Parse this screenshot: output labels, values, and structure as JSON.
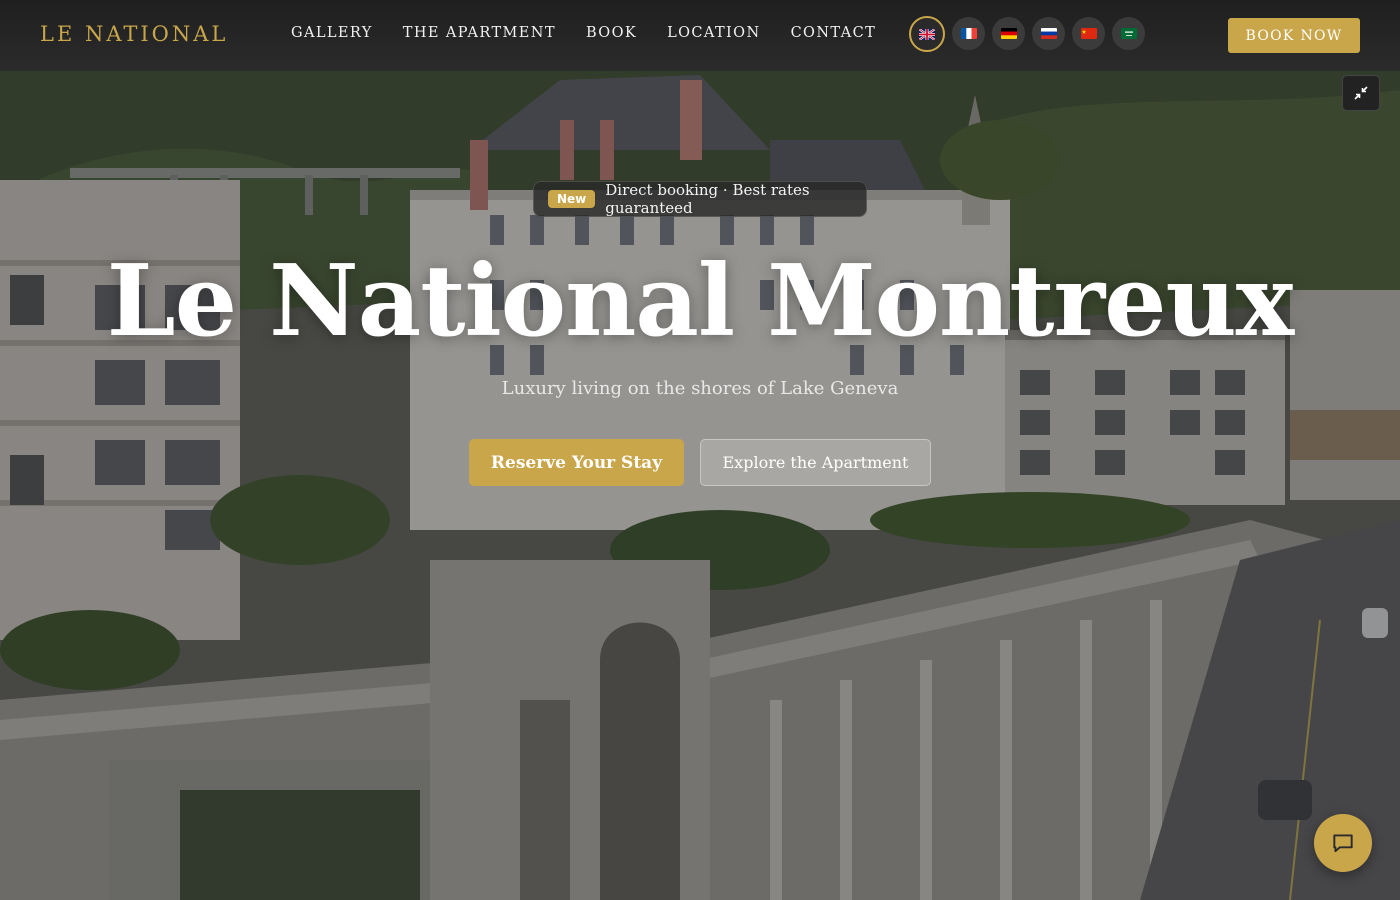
{
  "brand": {
    "name": "LE NATIONAL"
  },
  "nav": {
    "items": [
      {
        "label": "GALLERY"
      },
      {
        "label": "THE APARTMENT"
      },
      {
        "label": "BOOK"
      },
      {
        "label": "LOCATION"
      },
      {
        "label": "CONTACT"
      }
    ],
    "book_label": "BOOK NOW"
  },
  "languages": [
    {
      "code": "en",
      "icon": "flag-uk-icon",
      "active": true
    },
    {
      "code": "fr",
      "icon": "flag-france-icon",
      "active": false
    },
    {
      "code": "de",
      "icon": "flag-germany-icon",
      "active": false
    },
    {
      "code": "ru",
      "icon": "flag-russia-icon",
      "active": false
    },
    {
      "code": "zh",
      "icon": "flag-china-icon",
      "active": false
    },
    {
      "code": "ar",
      "icon": "flag-saudi-icon",
      "active": false
    }
  ],
  "hero": {
    "badge_tag": "New",
    "badge_text": "Direct booking · Best rates guaranteed",
    "title": "Le National Montreux",
    "subtitle": "Luxury living on the shores of Lake Geneva",
    "primary_cta": "Reserve Your Stay",
    "secondary_cta": "Explore the Apartment"
  },
  "icons": {
    "collapse": "collapse-arrows-icon",
    "chat": "chat-bubble-icon"
  },
  "colors": {
    "accent": "#c9a64a",
    "navbar": "#262626"
  }
}
